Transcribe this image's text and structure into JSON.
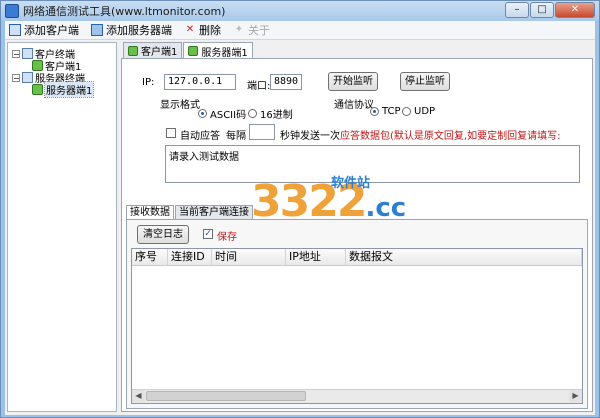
{
  "window": {
    "title": "网络通信测试工具(www.ltmonitor.com)",
    "buttons": [
      "–",
      "□",
      "✕"
    ]
  },
  "toolbar": {
    "add_client": "添加客户端",
    "add_server": "添加服务器端",
    "delete": "删除",
    "about": "关于"
  },
  "tree": {
    "client_root": "客户终端",
    "client_child": "客户端1",
    "server_root": "服务器终端",
    "server_child": "服务器端1"
  },
  "tabs": [
    "客户端1",
    "服务器端1"
  ],
  "form": {
    "ip_label": "IP:",
    "ip_value": "127.0.0.1",
    "port_label": "端口:",
    "port_value": "8890",
    "start_button": "开始监听",
    "stop_button": "停止监听",
    "display_format_label": "显示格式",
    "format_ascii": "ASCII码",
    "format_hex": "16进制",
    "protocol_label": "通信协议",
    "protocol_tcp": "TCP",
    "protocol_udp": "UDP",
    "auto_reply_label": "自动应答",
    "interval_label": "每隔",
    "interval_value": "",
    "interval_suffix": "秒钟发送一次",
    "reply_note": "应答数据包(默认是原文回复,如要定制回复请填写:",
    "reply_text": "请录入测试数据"
  },
  "subtabs": [
    "接收数据",
    "当前客户端连接"
  ],
  "receive": {
    "clear_button": "清空日志",
    "save_label": "保存",
    "columns": [
      "序号",
      "连接ID",
      "时间",
      "IP地址",
      "数据报文"
    ]
  },
  "watermark": {
    "number": "3322",
    "suffix": ".cc",
    "tagline": "软件站"
  },
  "colors": {
    "accent": "#9cc3e6",
    "red_text": "#c31818",
    "watermark_orange": "#f0a23a",
    "watermark_blue": "#2f7fd1"
  }
}
